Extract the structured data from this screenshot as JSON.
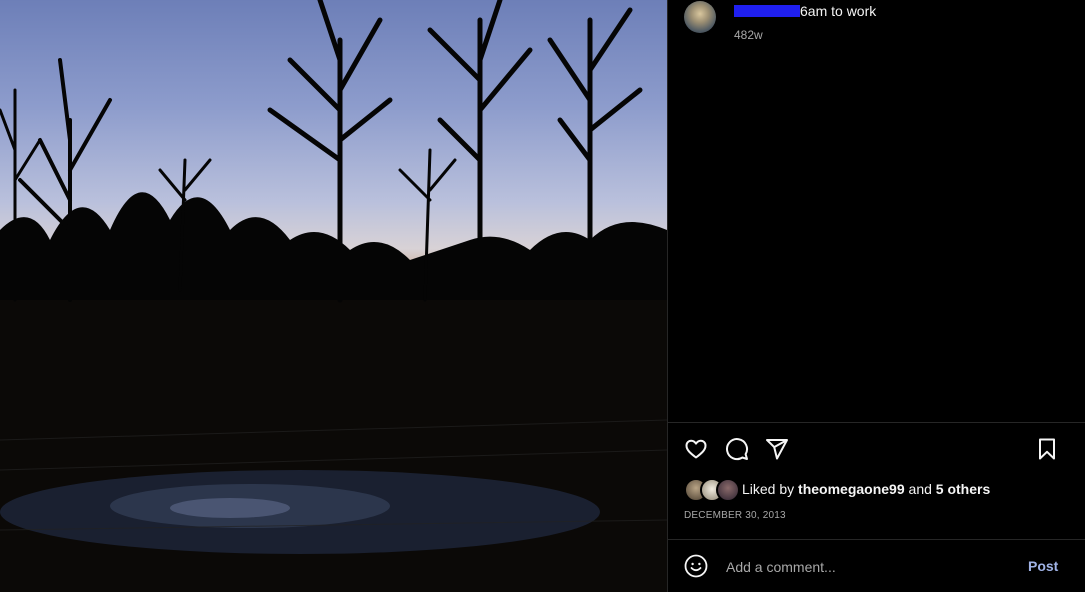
{
  "post": {
    "caption_text": "6am to work",
    "age": "482w",
    "date": "DECEMBER 30, 2013"
  },
  "likes": {
    "prefix": "Liked by ",
    "user": "theomegaone99",
    "joiner": " and ",
    "others": "5 others"
  },
  "comment": {
    "placeholder": "Add a comment...",
    "post_label": "Post"
  },
  "icons": [
    "heart-icon",
    "comment-icon",
    "share-icon",
    "bookmark-icon",
    "emoji-icon"
  ],
  "colors": {
    "background": "#000000",
    "divider": "#262626",
    "muted_text": "#a8a8a8",
    "post_button": "#a0b3e6",
    "redaction": "#1f1ff0"
  }
}
